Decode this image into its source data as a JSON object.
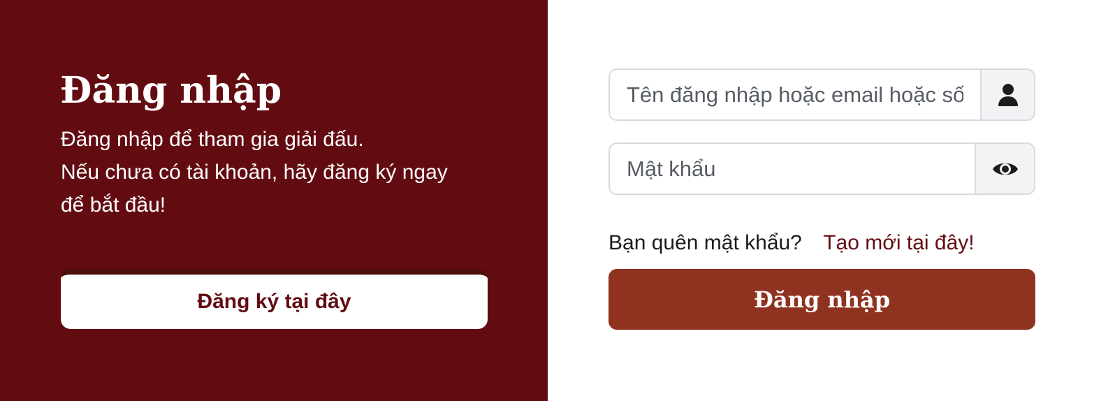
{
  "left_panel": {
    "title": "Đăng nhập",
    "description_lines": [
      "Đăng nhập để tham gia giải đấu.",
      "Nếu chưa có tài khoản, hãy đăng ký ngay",
      "để bắt đầu!"
    ],
    "register_label": "Đăng ký tại đây",
    "background_color": "#620c12"
  },
  "form": {
    "username": {
      "value": "",
      "placeholder": "Tên đăng nhập hoặc email hoặc số điện thoại",
      "icon": "user-icon"
    },
    "password": {
      "value": "",
      "placeholder": "Mật khẩu",
      "icon": "eye-icon"
    },
    "forgot_label": "Bạn quên mật khẩu?",
    "forgot_link": "Tạo mới tại đây!",
    "login_label": "Đăng nhập",
    "login_button_color": "#8f3320"
  }
}
